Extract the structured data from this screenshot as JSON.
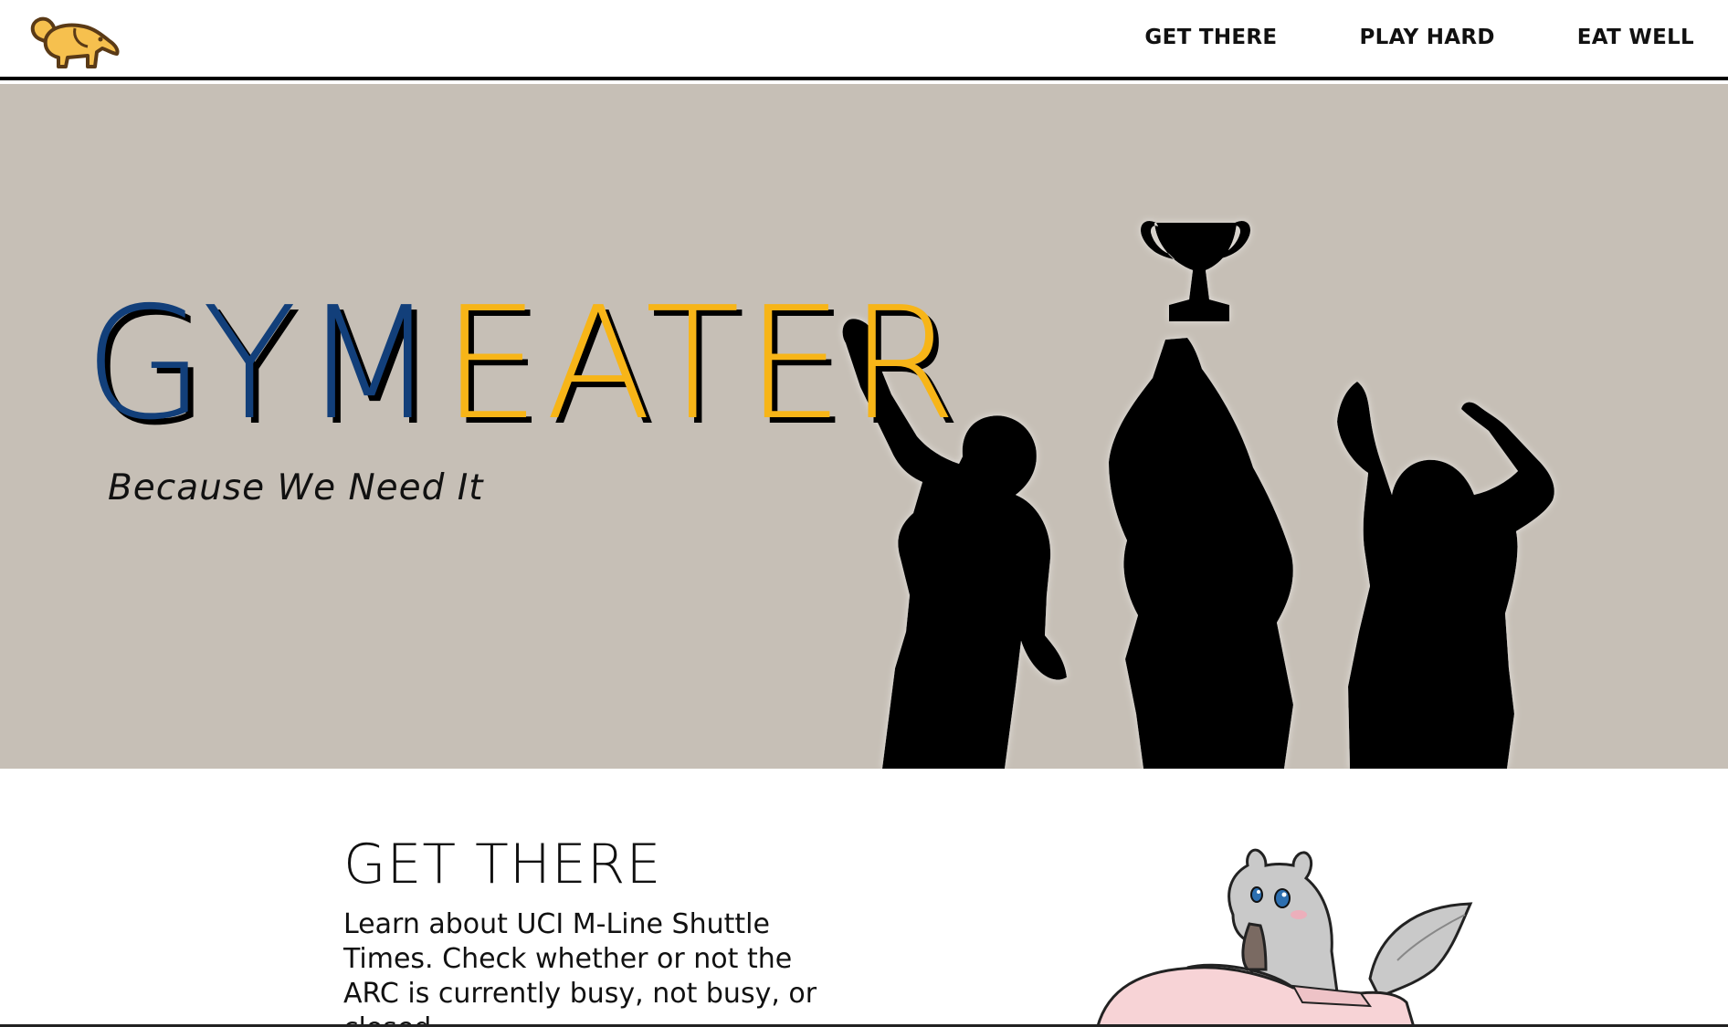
{
  "nav": {
    "logo_icon": "anteater-logo-icon",
    "links": [
      {
        "label": "GET THERE"
      },
      {
        "label": "PLAY HARD"
      },
      {
        "label": "EAT WELL"
      }
    ]
  },
  "hero": {
    "title_part_1": "GYM",
    "title_part_2": "EATER",
    "tagline": "Because We Need It",
    "image": "trophy-celebration-silhouettes",
    "colors": {
      "background": "#c6bfb6",
      "gym": "#123f7a",
      "eater": "#f7b518"
    }
  },
  "section": {
    "title": "GET THERE",
    "body": "Learn about UCI M-Line Shuttle Times. Check whether or not the ARC is currently busy, not busy, or closed.",
    "illustration": "anteater-mascot-in-car"
  }
}
